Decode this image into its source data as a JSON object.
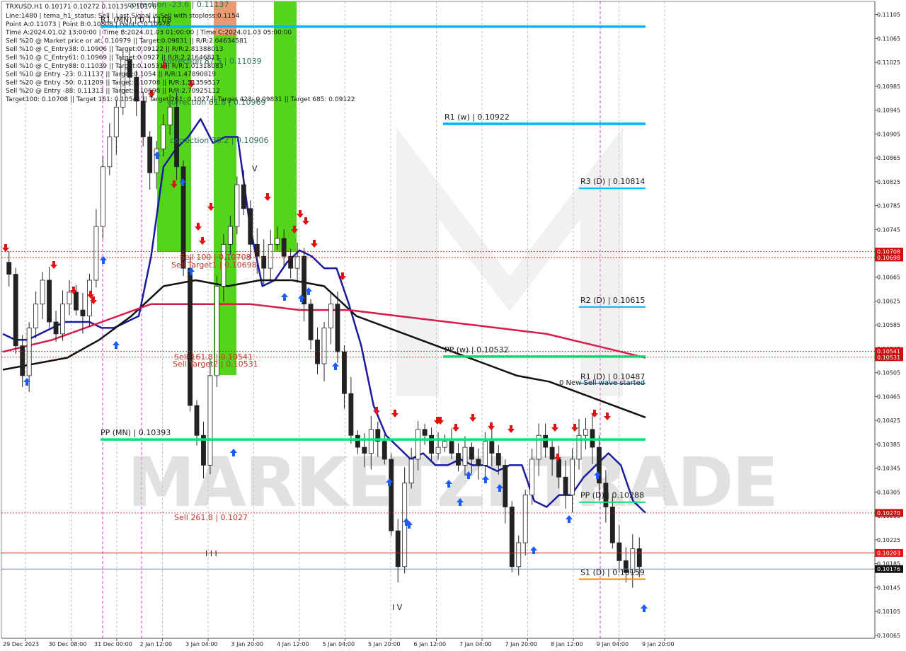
{
  "window": {
    "symbol_line": "TRXUSD,H1  0.10171 0.10272 0.10135 0.10176"
  },
  "info_lines": [
    "Line:1480 | tema_h1_status: Sell | Last Signal is:Sell with stoploss:0.1154",
    "Point A:0.11073 | Point B:0.10808 | Point C:0.10978",
    "Time A:2024.01.02 13:00:00 | Time B:2024.01.03 01:00:00 | Time C:2024.01.03 05:00:00",
    "Sell %20 @ Market price or at: 0.10979 || Target:0.09831 || R/R:2.04634581",
    "Sell %10 @ C_Entry38: 0.10906 || Target:0.09122 || R/R:2.81388013",
    "Sell %10 @ C_Entry61: 0.10969 || Target:0.0927 || R/R:2.21646813",
    "Sell %10 @ C_Entry88: 0.11039 || Target:0.10531 || R/R:1.01318083",
    "Sell %10 @ Entry -23: 0.11137 || Target:0.1054 || R/R:1.47890819",
    "Sell %20 @ Entry -50: 0.11209 || Target:0.10708 || R/R:1.51359517",
    "Sell %20 @ Entry -88: 0.11313 || Target:0.10698 || R/R:2.70925112",
    "Target100: 0.10708 || Target 161: 0.10541 || Target 261: 0.1027 || Target 423: 0.09831 || Target 685: 0.09122"
  ],
  "levels": [
    {
      "label": "R1 (MN) | 0.11108",
      "value": 0.11085,
      "color": "#00b4ff"
    },
    {
      "label": "R1 (w) | 0.10922",
      "value": 0.10922,
      "color": "#00b4ff"
    },
    {
      "label": "R3 (D) | 0.10814",
      "value": 0.10814,
      "color": "#00b4ff"
    },
    {
      "label": "R2 (D) | 0.10615",
      "value": 0.10615,
      "color": "#00b4ff"
    },
    {
      "label": "PP (w) | 0.10532",
      "value": 0.10532,
      "color": "#00e676"
    },
    {
      "label": "R1 (D) | 0.10487",
      "value": 0.10487,
      "color": "#00b4ff"
    },
    {
      "label": "PP (MN) | 0.10393",
      "value": 0.10393,
      "color": "#00e676"
    },
    {
      "label": "PP (D) | 0.10288",
      "value": 0.10288,
      "color": "#00e676"
    },
    {
      "label": "S1 (D) | 0.10159",
      "value": 0.10159,
      "color": "#ff8c00"
    }
  ],
  "annotations": {
    "sell_100": "Sell 100 | 0.10708",
    "sell_target_1": "Sell Target1 | 0.10698",
    "sell_161": "Sell 161.8 | 0.10541",
    "sell_target_2": "Sell Target2 | 0.10531",
    "sell_261": "Sell 261.8 | 0.1027",
    "correction_38": "correction 38.2 | 0.10906",
    "correction_61": "correction 61.8 | 0.10969",
    "correction_87": "correction 87.5 | 0.11039",
    "correction_23": "correction -23.6 | 0.11137",
    "new_sell_wave": "0 New Sell wave started",
    "wave_v": "V",
    "wave_iii": "I I I",
    "wave_iv": "I V"
  },
  "price_tags": [
    {
      "value": 0.10708,
      "text": "0.10708",
      "color": "#cc1111"
    },
    {
      "value": 0.10698,
      "text": "0.10698",
      "color": "#cc1111"
    },
    {
      "value": 0.10541,
      "text": "0.10541",
      "color": "#cc1111"
    },
    {
      "value": 0.10531,
      "text": "0.10531",
      "color": "#cc1111"
    },
    {
      "value": 0.1027,
      "text": "0.10270",
      "color": "#cc1111"
    },
    {
      "value": 0.10203,
      "text": "0.10203",
      "color": "#ee1111"
    },
    {
      "value": 0.10176,
      "text": "0.10176",
      "color": "#111111"
    }
  ],
  "watermark": "MARKETZI TRADE",
  "chart_data": {
    "type": "candlestick",
    "symbol": "TRXUSD",
    "timeframe": "H1",
    "ohlc_last": {
      "open": 0.10171,
      "high": 0.10272,
      "low": 0.10135,
      "close": 0.10176
    },
    "ylim": [
      0.1006,
      0.1112
    ],
    "y_ticks": [
      "0.11105",
      "0.11065",
      "0.11025",
      "0.10985",
      "0.10945",
      "0.10905",
      "0.10865",
      "0.10825",
      "0.10785",
      "0.10745",
      "0.10705",
      "0.10665",
      "0.10625",
      "0.10585",
      "0.10545",
      "0.10505",
      "0.10465",
      "0.10425",
      "0.10385",
      "0.10345",
      "0.10305",
      "0.10265",
      "0.10225",
      "0.10185",
      "0.10145",
      "0.10105",
      "0.10065"
    ],
    "x_ticks": [
      "29 Dec 2023",
      "30 Dec 08:00",
      "31 Dec 00:00",
      "2 Jan 12:00",
      "3 Jan 04:00",
      "3 Jan 20:00",
      "4 Jan 12:00",
      "5 Jan 04:00",
      "5 Jan 20:00",
      "6 Jan 12:00",
      "7 Jan 04:00",
      "7 Jan 20:00",
      "8 Jan 12:00",
      "9 Jan 04:00",
      "9 Jan 20:00"
    ],
    "closes": [
      0.1067,
      0.1055,
      0.105,
      0.1058,
      0.1062,
      0.1066,
      0.1059,
      0.1057,
      0.1062,
      0.1064,
      0.1061,
      0.106,
      0.1066,
      0.1075,
      0.1085,
      0.109,
      0.1095,
      0.1103,
      0.11,
      0.1096,
      0.109,
      0.1084,
      0.1088,
      0.1092,
      0.1095,
      0.1085,
      0.1068,
      0.1045,
      0.104,
      0.1035,
      0.105,
      0.1065,
      0.1072,
      0.1075,
      0.1082,
      0.1078,
      0.1072,
      0.107,
      0.1068,
      0.1072,
      0.1073,
      0.107,
      0.1068,
      0.107,
      0.1062,
      0.1056,
      0.1052,
      0.1058,
      0.1062,
      0.1054,
      0.1047,
      0.104,
      0.1038,
      0.1037,
      0.1041,
      0.1039,
      0.1036,
      0.1024,
      0.1018,
      0.1032,
      0.1036,
      0.1041,
      0.104,
      0.1037,
      0.1038,
      0.1039,
      0.1037,
      0.1035,
      0.1038,
      0.1036,
      0.1035,
      0.1039,
      0.1037,
      0.1035,
      0.1028,
      0.1018,
      0.1022,
      0.103,
      0.1036,
      0.104,
      0.1038,
      0.1036,
      0.1033,
      0.103,
      0.1036,
      0.104,
      0.1041,
      0.1038,
      0.1032,
      0.1028,
      0.1022,
      0.1019,
      0.1017,
      0.1021,
      0.1018
    ],
    "series": [
      {
        "name": "EMA fast",
        "color": "#1a1aa0",
        "values": [
          0.1057,
          0.1056,
          0.1056,
          0.1057,
          0.1058,
          0.1059,
          0.1059,
          0.1059,
          0.1058,
          0.1058,
          0.1059,
          0.106,
          0.107,
          0.1085,
          0.1088,
          0.109,
          0.1093,
          0.1089,
          0.109,
          0.109,
          0.1075,
          0.1065,
          0.1066,
          0.1069,
          0.1071,
          0.107,
          0.1068,
          0.1068,
          0.1062,
          0.1055,
          0.1045,
          0.104,
          0.1038,
          0.1036,
          0.1037,
          0.1035,
          0.1035,
          0.1036,
          0.1035,
          0.1035,
          0.1034,
          0.1035,
          0.1035,
          0.1029,
          0.1028,
          0.103,
          0.103,
          0.1033,
          0.1035,
          0.1037,
          0.1035,
          0.1029,
          0.1027
        ]
      },
      {
        "name": "SMA slow",
        "color": "#111111",
        "values": [
          0.1051,
          0.1052,
          0.1053,
          0.1056,
          0.106,
          0.1065,
          0.1066,
          0.1065,
          0.1066,
          0.1066,
          0.1065,
          0.106,
          0.1058,
          0.1056,
          0.1054,
          0.1052,
          0.105,
          0.1049,
          0.1047,
          0.1045,
          0.1043
        ]
      },
      {
        "name": "SMA long",
        "color": "#d81b4a",
        "values": [
          0.1054,
          0.1056,
          0.1059,
          0.1062,
          0.1062,
          0.1062,
          0.1061,
          0.1061,
          0.106,
          0.1059,
          0.1058,
          0.1057,
          0.1055,
          0.1053
        ]
      }
    ]
  }
}
